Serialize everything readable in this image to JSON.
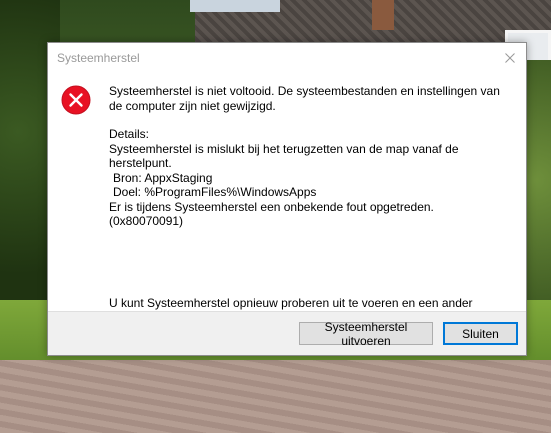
{
  "dialog": {
    "title": "Systeemherstel",
    "message": "Systeemherstel is niet voltooid. De systeembestanden en instellingen van de computer zijn niet gewijzigd.",
    "details_label": "Details:",
    "details": {
      "line1": "Systeemherstel is mislukt bij het terugzetten van de map vanaf de herstelpunt.",
      "line2": "Bron: AppxStaging",
      "line3": "Doel: %ProgramFiles%\\WindowsApps",
      "line4": "Er is tijdens Systeemherstel een onbekende fout opgetreden. (0x80070091)"
    },
    "retry_text": "U kunt Systeemherstel opnieuw proberen uit te voeren en een ander herstelpunt kiezen. Als deze fout zich opnieuw voordoet, kunt u een geavanceerde herstelmethode proberen.",
    "buttons": {
      "execute": "Systeemherstel uitvoeren",
      "close": "Sluiten"
    },
    "icons": {
      "status": "error-icon",
      "close": "close-icon"
    },
    "colors": {
      "error_red": "#e81123",
      "focus_blue": "#0078d7"
    }
  }
}
